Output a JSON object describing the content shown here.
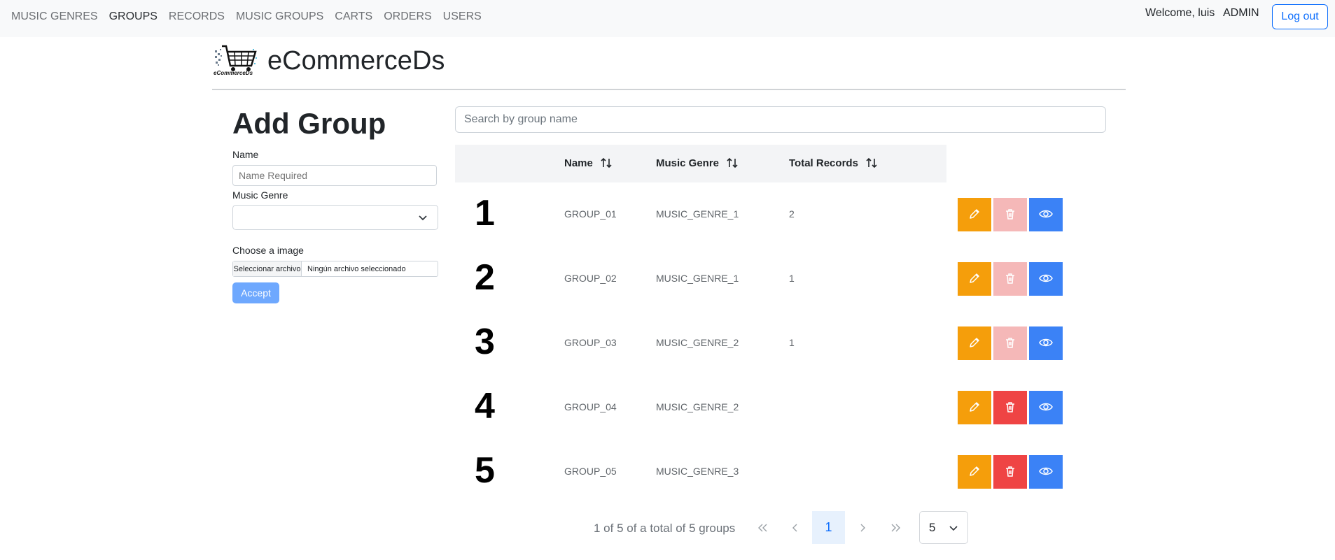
{
  "nav": {
    "links": [
      "MUSIC GENRES",
      "GROUPS",
      "RECORDS",
      "MUSIC GROUPS",
      "CARTS",
      "ORDERS",
      "USERS"
    ],
    "welcome": "Welcome, luis",
    "role": "ADMIN",
    "logout": "Log out"
  },
  "brand": {
    "title": "eCommerceDs",
    "logo_caption": "eCommerceDs",
    "logo_icon": "shopping-cart-icon"
  },
  "form": {
    "title": "Add Group",
    "name_label": "Name",
    "name_placeholder": "Name Required",
    "genre_label": "Music Genre",
    "genre_value": "",
    "image_label": "Choose a image",
    "file_button": "Seleccionar archivo",
    "file_status": "Ningún archivo seleccionado",
    "accept": "Accept"
  },
  "search": {
    "placeholder": "Search by group name"
  },
  "table": {
    "headers": [
      "Name",
      "Music Genre",
      "Total Records"
    ],
    "rows": [
      {
        "num": "1",
        "name": "GROUP_01",
        "genre": "MUSIC_GENRE_1",
        "total": "2",
        "delete_enabled": false
      },
      {
        "num": "2",
        "name": "GROUP_02",
        "genre": "MUSIC_GENRE_1",
        "total": "1",
        "delete_enabled": false
      },
      {
        "num": "3",
        "name": "GROUP_03",
        "genre": "MUSIC_GENRE_2",
        "total": "1",
        "delete_enabled": false
      },
      {
        "num": "4",
        "name": "GROUP_04",
        "genre": "MUSIC_GENRE_2",
        "total": "",
        "delete_enabled": true
      },
      {
        "num": "5",
        "name": "GROUP_05",
        "genre": "MUSIC_GENRE_3",
        "total": "",
        "delete_enabled": true
      }
    ]
  },
  "pagination": {
    "summary": "1 of 5 of a total of 5 groups",
    "current_page": "1",
    "page_size": "5",
    "icons": [
      "double-chevron-left-icon",
      "chevron-left-icon",
      "chevron-right-icon",
      "double-chevron-right-icon"
    ]
  },
  "colors": {
    "edit": "#f59e0b",
    "delete": "#ef4444",
    "delete_disabled": "#f5b8b8",
    "view": "#3b82f6",
    "accent": "#0d6efd"
  }
}
